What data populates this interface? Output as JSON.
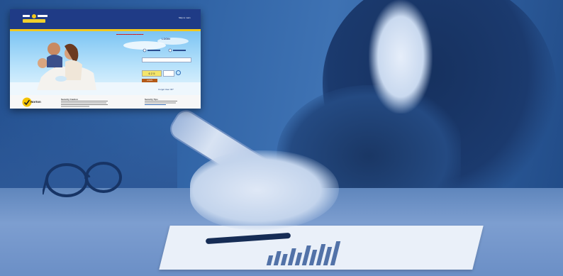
{
  "inset": {
    "header_link": "Skip to main",
    "login_title": "LOGIN",
    "captcha_code": "6 2 5",
    "login_button": "LOGIN",
    "forgot_link": "Forgot User ID?",
    "norton_label": "Norton",
    "security_title": "Security Caution",
    "security_title_2": "Security Tips"
  },
  "colors": {
    "overlay_blue": "#2f62a4",
    "header_navy": "#1f3b86",
    "accent_yellow": "#f2c81d"
  }
}
